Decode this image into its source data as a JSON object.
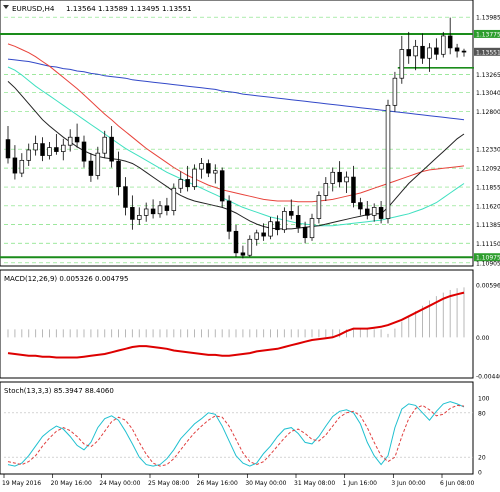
{
  "header": {
    "symbol": "EURUSD,H4",
    "ohlc": "1.13564 1.13589 1.13495 1.13551"
  },
  "colors": {
    "bull": "#ffffff",
    "bear": "#000000",
    "ma_red": "#e8433b",
    "ma_blue": "#3248c8",
    "ma_cyan": "#3fe0c0",
    "ma_black": "#222222",
    "level_green": "#1a8c1a",
    "grid_green": "#7ee07e",
    "macd_line": "#dd0000",
    "macd_hist": "#b0b0b0",
    "stoch_main": "#20c0d0",
    "stoch_signal": "#e04040",
    "price_label_bg": "#2e9e2e"
  },
  "price_axis": {
    "labels": [
      "1.13985",
      "1.13775",
      "1.13551",
      "1.13265",
      "1.13040",
      "1.12800",
      "1.12330",
      "1.12092",
      "1.11855",
      "1.11620",
      "1.11385",
      "1.11150",
      "1.10975",
      "1.10905"
    ],
    "highlighted": [
      "1.13775",
      "1.10975"
    ],
    "current": "1.13551"
  },
  "macd": {
    "label": "MACD(12,26,9) 0.005326 0.004795",
    "axis": [
      "0.005965",
      "0.00",
      "-0.004404"
    ]
  },
  "stoch": {
    "label": "Stoch(13,3,3) 85.3947 88.4060",
    "axis": [
      "100",
      "80",
      "20",
      "0"
    ]
  },
  "time_axis": [
    "19 May 2016",
    "20 May 16:00",
    "24 May 00:00",
    "25 May 08:00",
    "26 May 16:00",
    "30 May 00:00",
    "31 May 08:00",
    "1 Jun 16:00",
    "3 Jun 00:00",
    "6 Jun 08:00"
  ],
  "chart_data": {
    "type": "candlestick",
    "y_range": [
      1.1089,
      1.14
    ],
    "candles": [
      [
        1.1245,
        1.1262,
        1.1215,
        1.1222
      ],
      [
        1.1222,
        1.1238,
        1.1195,
        1.1203
      ],
      [
        1.1203,
        1.1228,
        1.1198,
        1.1219
      ],
      [
        1.1219,
        1.124,
        1.1212,
        1.1232
      ],
      [
        1.1232,
        1.125,
        1.1225,
        1.124
      ],
      [
        1.124,
        1.1248,
        1.1218,
        1.1225
      ],
      [
        1.1225,
        1.1242,
        1.122,
        1.1235
      ],
      [
        1.1235,
        1.1252,
        1.1226,
        1.123
      ],
      [
        1.123,
        1.1246,
        1.1219,
        1.1238
      ],
      [
        1.1238,
        1.1258,
        1.123,
        1.1248
      ],
      [
        1.1248,
        1.1265,
        1.1235,
        1.1242
      ],
      [
        1.1242,
        1.125,
        1.121,
        1.1218
      ],
      [
        1.1218,
        1.1228,
        1.1192,
        1.12
      ],
      [
        1.12,
        1.1236,
        1.1195,
        1.1228
      ],
      [
        1.1228,
        1.1256,
        1.1222,
        1.1248
      ],
      [
        1.1248,
        1.1262,
        1.121,
        1.1218
      ],
      [
        1.1218,
        1.123,
        1.1175,
        1.1186
      ],
      [
        1.1186,
        1.1198,
        1.115,
        1.116
      ],
      [
        1.116,
        1.1175,
        1.1132,
        1.1145
      ],
      [
        1.1145,
        1.116,
        1.1138,
        1.115
      ],
      [
        1.115,
        1.1166,
        1.1142,
        1.1158
      ],
      [
        1.1158,
        1.117,
        1.1146,
        1.1152
      ],
      [
        1.1152,
        1.1168,
        1.1147,
        1.1162
      ],
      [
        1.1162,
        1.1172,
        1.115,
        1.1156
      ],
      [
        1.1156,
        1.119,
        1.115,
        1.1184
      ],
      [
        1.1184,
        1.1205,
        1.1178,
        1.1195
      ],
      [
        1.1195,
        1.1212,
        1.118,
        1.1186
      ],
      [
        1.1186,
        1.1214,
        1.1182,
        1.1208
      ],
      [
        1.1208,
        1.1222,
        1.1196,
        1.1215
      ],
      [
        1.1215,
        1.122,
        1.1198,
        1.1203
      ],
      [
        1.1203,
        1.1214,
        1.119,
        1.1206
      ],
      [
        1.1206,
        1.121,
        1.116,
        1.1168
      ],
      [
        1.1168,
        1.1175,
        1.112,
        1.113
      ],
      [
        1.113,
        1.1138,
        1.1098,
        1.1103
      ],
      [
        1.1103,
        1.1112,
        1.1096,
        1.11
      ],
      [
        1.11,
        1.1125,
        1.1098,
        1.112
      ],
      [
        1.112,
        1.1132,
        1.1112,
        1.1128
      ],
      [
        1.1128,
        1.114,
        1.1118,
        1.1124
      ],
      [
        1.1124,
        1.1148,
        1.112,
        1.1142
      ],
      [
        1.1142,
        1.115,
        1.1125,
        1.1132
      ],
      [
        1.1132,
        1.116,
        1.1128,
        1.1155
      ],
      [
        1.1155,
        1.117,
        1.1145,
        1.115
      ],
      [
        1.115,
        1.1162,
        1.1128,
        1.1135
      ],
      [
        1.1135,
        1.1142,
        1.1115,
        1.1122
      ],
      [
        1.1122,
        1.1152,
        1.1118,
        1.1146
      ],
      [
        1.1146,
        1.118,
        1.114,
        1.1175
      ],
      [
        1.1175,
        1.1198,
        1.1168,
        1.119
      ],
      [
        1.119,
        1.121,
        1.118,
        1.1204
      ],
      [
        1.1204,
        1.1218,
        1.1185,
        1.1192
      ],
      [
        1.1192,
        1.1205,
        1.1178,
        1.1198
      ],
      [
        1.1198,
        1.1212,
        1.116,
        1.1166
      ],
      [
        1.1166,
        1.1172,
        1.115,
        1.1158
      ],
      [
        1.1158,
        1.1168,
        1.1145,
        1.115
      ],
      [
        1.115,
        1.1165,
        1.1142,
        1.116
      ],
      [
        1.116,
        1.1168,
        1.114,
        1.1146
      ],
      [
        1.1146,
        1.1295,
        1.114,
        1.1288
      ],
      [
        1.1288,
        1.133,
        1.128,
        1.1322
      ],
      [
        1.1322,
        1.1375,
        1.1315,
        1.1358
      ],
      [
        1.1358,
        1.138,
        1.134,
        1.135
      ],
      [
        1.135,
        1.137,
        1.1332,
        1.1362
      ],
      [
        1.1362,
        1.1378,
        1.134,
        1.1347
      ],
      [
        1.1347,
        1.1366,
        1.133,
        1.136
      ],
      [
        1.136,
        1.1372,
        1.1345,
        1.1352
      ],
      [
        1.1352,
        1.138,
        1.1348,
        1.1375
      ],
      [
        1.1375,
        1.1398,
        1.1352,
        1.136
      ],
      [
        1.136,
        1.1365,
        1.1348,
        1.1356
      ],
      [
        1.1356,
        1.1359,
        1.1349,
        1.1355
      ]
    ],
    "ma_red": [
      1.1365,
      1.1362,
      1.1358,
      1.1354,
      1.1349,
      1.1343,
      1.1337,
      1.133,
      1.1323,
      1.1316,
      1.1309,
      1.1301,
      1.1293,
      1.1285,
      1.1277,
      1.127,
      1.1262,
      1.1255,
      1.1248,
      1.1241,
      1.1234,
      1.1228,
      1.1222,
      1.1216,
      1.121,
      1.1205,
      1.12,
      1.1196,
      1.1192,
      1.1188,
      1.1185,
      1.1182,
      1.118,
      1.1178,
      1.1176,
      1.1174,
      1.1172,
      1.117,
      1.1169,
      1.1168,
      1.1168,
      1.1168,
      1.1167,
      1.1167,
      1.1167,
      1.1168,
      1.1169,
      1.117,
      1.1172,
      1.1174,
      1.1176,
      1.1178,
      1.1181,
      1.1184,
      1.1187,
      1.119,
      1.1193,
      1.1196,
      1.1199,
      1.1202,
      1.1205,
      1.1207,
      1.1208,
      1.1209,
      1.121,
      1.1211,
      1.1212
    ],
    "ma_blue": [
      1.1346,
      1.1345,
      1.1344,
      1.1343,
      1.1341,
      1.1339,
      1.1337,
      1.1336,
      1.1334,
      1.1333,
      1.1331,
      1.133,
      1.1328,
      1.1327,
      1.1325,
      1.1324,
      1.1323,
      1.1322,
      1.132,
      1.1319,
      1.1318,
      1.1317,
      1.1316,
      1.1315,
      1.1314,
      1.1313,
      1.1312,
      1.1311,
      1.131,
      1.1309,
      1.1308,
      1.1306,
      1.1305,
      1.1304,
      1.1302,
      1.1301,
      1.13,
      1.1299,
      1.1298,
      1.1297,
      1.1296,
      1.1295,
      1.1294,
      1.1293,
      1.1292,
      1.1291,
      1.129,
      1.1289,
      1.1288,
      1.1287,
      1.1286,
      1.1285,
      1.1284,
      1.1283,
      1.1282,
      1.1281,
      1.128,
      1.1279,
      1.1278,
      1.1277,
      1.1276,
      1.1275,
      1.1274,
      1.1273,
      1.1272,
      1.1271,
      1.127
    ],
    "ma_cyan": [
      1.1336,
      1.1332,
      1.1326,
      1.1319,
      1.1312,
      1.1306,
      1.13,
      1.1294,
      1.1288,
      1.1282,
      1.1276,
      1.127,
      1.1264,
      1.1258,
      1.1252,
      1.1246,
      1.124,
      1.1234,
      1.1229,
      1.1224,
      1.1219,
      1.1214,
      1.1209,
      1.1204,
      1.12,
      1.1196,
      1.1192,
      1.1188,
      1.1184,
      1.118,
      1.1176,
      1.1172,
      1.1168,
      1.1164,
      1.116,
      1.1157,
      1.1154,
      1.1151,
      1.1148,
      1.1146,
      1.1144,
      1.1142,
      1.114,
      1.1139,
      1.1138,
      1.1137,
      1.1137,
      1.1137,
      1.1138,
      1.1139,
      1.114,
      1.1141,
      1.1142,
      1.1143,
      1.1144,
      1.1146,
      1.1148,
      1.115,
      1.1152,
      1.1155,
      1.1158,
      1.1162,
      1.1166,
      1.1172,
      1.1178,
      1.1184,
      1.119
    ],
    "ma_black": [
      1.1318,
      1.131,
      1.13,
      1.129,
      1.128,
      1.127,
      1.1262,
      1.1255,
      1.1248,
      1.1242,
      1.1236,
      1.1231,
      1.1227,
      1.1224,
      1.1222,
      1.1221,
      1.122,
      1.1218,
      1.1215,
      1.121,
      1.1204,
      1.1198,
      1.1192,
      1.1186,
      1.118,
      1.1175,
      1.1171,
      1.1168,
      1.1166,
      1.1164,
      1.1162,
      1.116,
      1.1157,
      1.1153,
      1.1148,
      1.1143,
      1.1139,
      1.1136,
      1.1134,
      1.1133,
      1.1133,
      1.1133,
      1.1134,
      1.1135,
      1.1136,
      1.1137,
      1.1139,
      1.1141,
      1.1143,
      1.1145,
      1.1147,
      1.1149,
      1.1151,
      1.1152,
      1.1152,
      1.116,
      1.117,
      1.118,
      1.119,
      1.1198,
      1.1206,
      1.1214,
      1.1222,
      1.123,
      1.1238,
      1.1246,
      1.1252
    ],
    "levels": [
      1.13775,
      1.10975
    ],
    "support_segment": {
      "from_index": 57,
      "to_index": 66,
      "price": 1.1335
    },
    "macd_range": [
      -0.004404,
      0.005965
    ],
    "macd_signal": [
      -0.0018,
      -0.0019,
      -0.002,
      -0.0021,
      -0.0021,
      -0.0022,
      -0.0022,
      -0.0023,
      -0.0023,
      -0.0023,
      -0.0023,
      -0.0022,
      -0.0021,
      -0.002,
      -0.0019,
      -0.0017,
      -0.0015,
      -0.0013,
      -0.0011,
      -0.001,
      -0.001,
      -0.0011,
      -0.0012,
      -0.0013,
      -0.0015,
      -0.0016,
      -0.0017,
      -0.0018,
      -0.0019,
      -0.002,
      -0.002,
      -0.0021,
      -0.0021,
      -0.002,
      -0.0019,
      -0.0018,
      -0.0016,
      -0.0015,
      -0.0014,
      -0.0013,
      -0.0011,
      -0.0009,
      -0.0007,
      -0.0005,
      -0.0003,
      -0.0002,
      -0.0001,
      0.0,
      0.0003,
      0.0007,
      0.001,
      0.001,
      0.001,
      0.0011,
      0.0012,
      0.0014,
      0.0017,
      0.002,
      0.0024,
      0.0028,
      0.0032,
      0.0036,
      0.004,
      0.0044,
      0.0047,
      0.0049,
      0.0051
    ],
    "macd_hist": [
      0.0,
      0.0,
      0.0,
      0.0,
      0.0,
      0.0,
      0.0,
      0.0,
      0.0,
      0.0,
      0.0,
      0.0,
      0.0,
      0.0,
      0.0,
      0.0,
      0.0,
      0.0,
      0.0,
      0.0,
      0.0,
      0.0,
      0.0,
      0.0,
      0.0,
      0.0,
      0.0,
      0.0,
      0.0,
      0.0,
      0.0,
      0.0,
      0.0,
      0.0,
      0.0,
      0.0,
      0.0,
      0.0,
      0.0,
      0.0,
      0.0,
      0.0,
      0.0,
      0.0,
      0.0,
      0.0,
      0.0,
      0.0,
      0.0,
      0.0,
      0.0,
      0.0,
      0.0,
      0.0,
      0.0,
      0.0004,
      0.001,
      0.0018,
      0.0024,
      0.003,
      0.0036,
      0.0042,
      0.0047,
      0.0051,
      0.0054,
      0.0056,
      0.0057
    ],
    "stoch_main": [
      10,
      8,
      12,
      22,
      35,
      48,
      56,
      62,
      58,
      48,
      36,
      30,
      40,
      60,
      72,
      76,
      70,
      55,
      38,
      20,
      10,
      8,
      10,
      18,
      30,
      45,
      55,
      65,
      72,
      80,
      78,
      62,
      42,
      22,
      12,
      8,
      12,
      25,
      35,
      48,
      58,
      60,
      52,
      40,
      38,
      48,
      62,
      75,
      82,
      84,
      80,
      65,
      40,
      22,
      10,
      22,
      60,
      85,
      92,
      90,
      80,
      70,
      82,
      92,
      95,
      92,
      88
    ],
    "stoch_signal": [
      14,
      12,
      10,
      14,
      22,
      35,
      46,
      55,
      60,
      56,
      48,
      38,
      34,
      42,
      55,
      68,
      74,
      70,
      58,
      40,
      24,
      12,
      8,
      10,
      18,
      30,
      42,
      53,
      62,
      70,
      76,
      74,
      62,
      44,
      26,
      14,
      10,
      14,
      24,
      35,
      46,
      55,
      58,
      52,
      44,
      42,
      50,
      62,
      74,
      80,
      82,
      76,
      60,
      40,
      22,
      14,
      20,
      48,
      72,
      86,
      90,
      84,
      76,
      78,
      86,
      90,
      89
    ]
  }
}
